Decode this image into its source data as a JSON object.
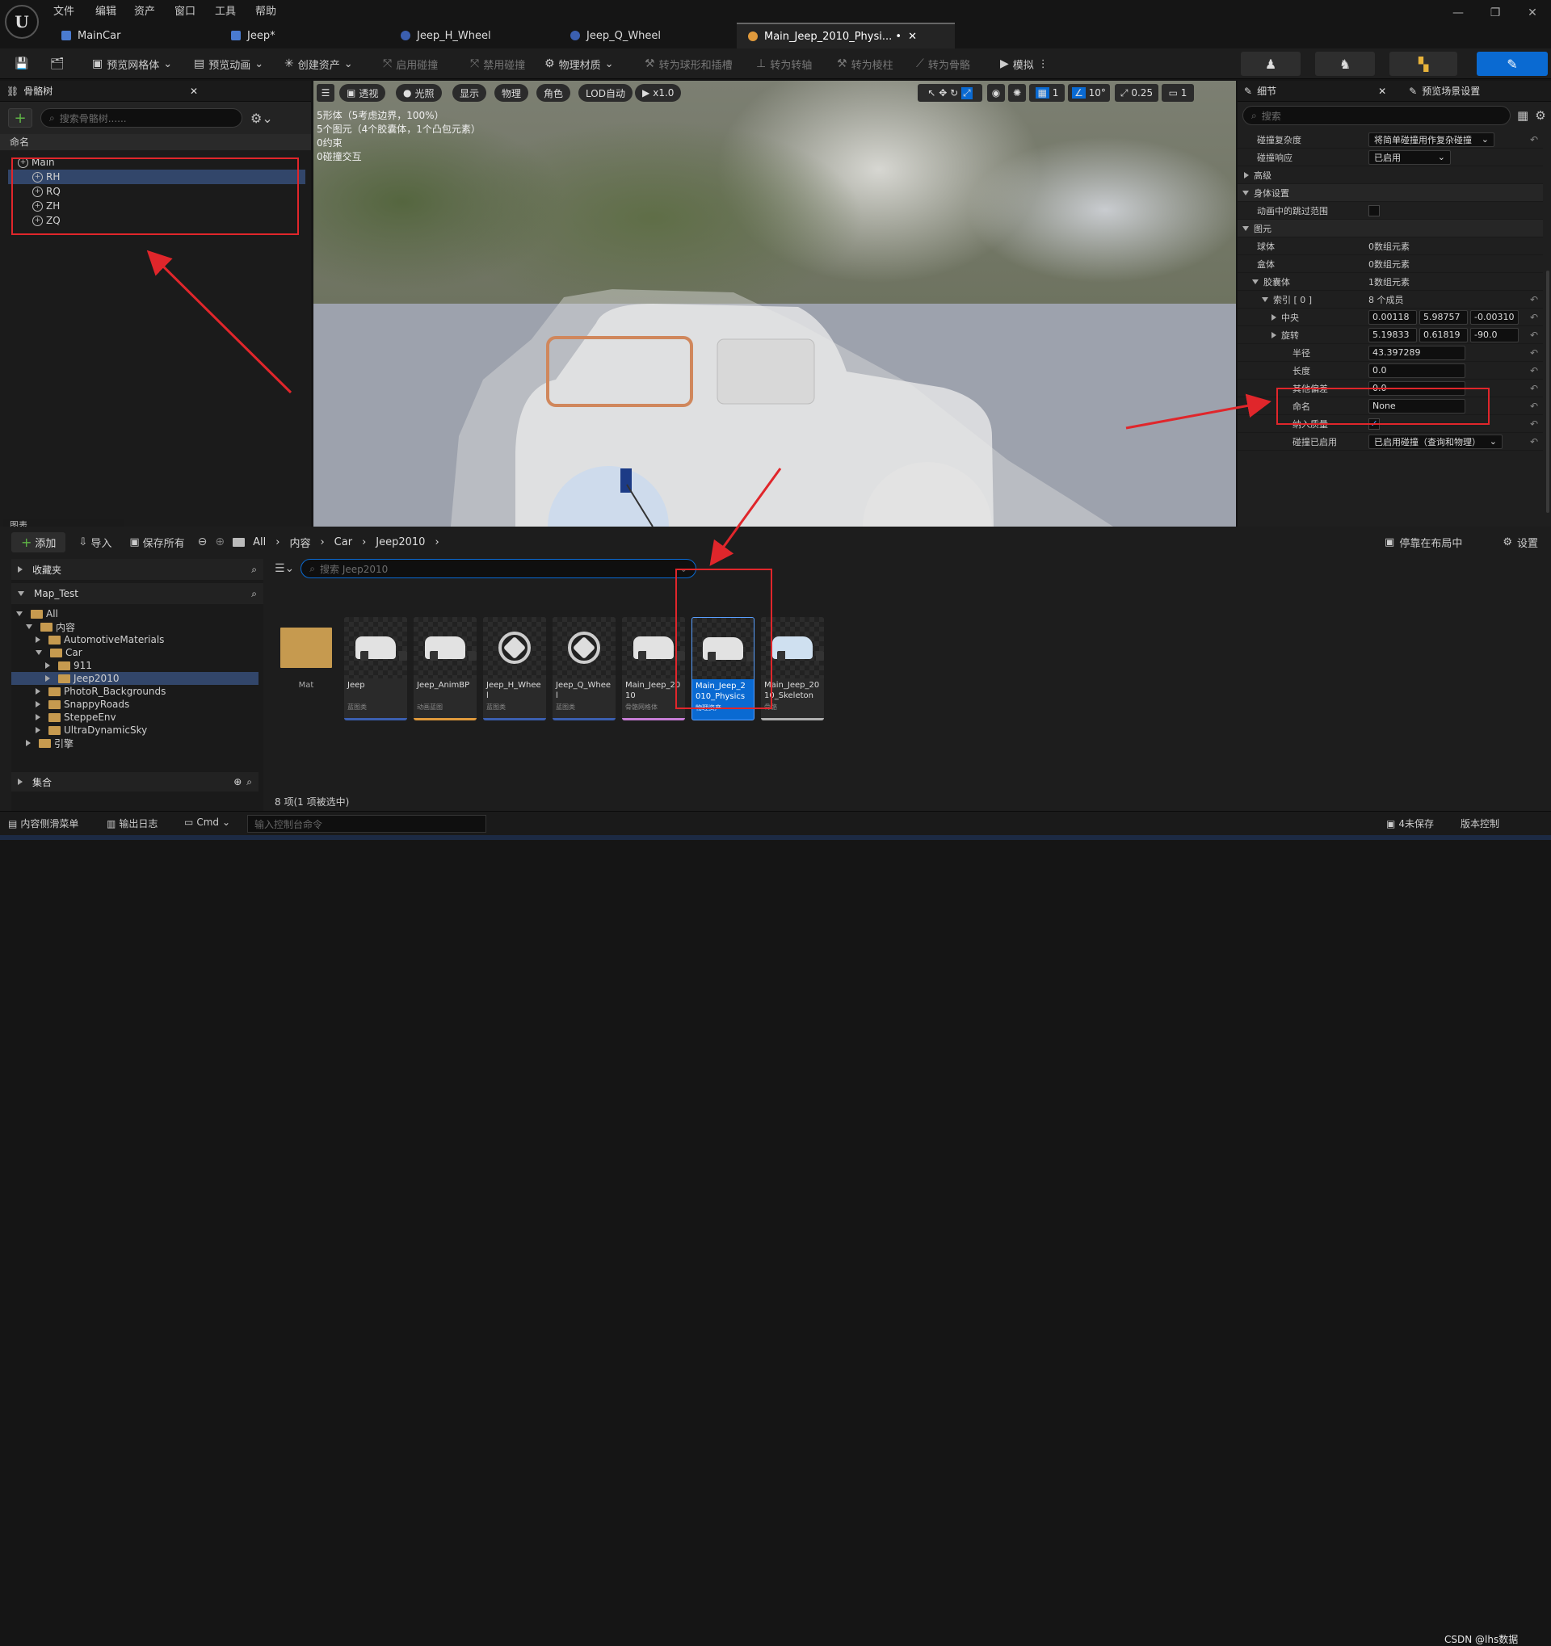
{
  "menu": {
    "file": "文件",
    "edit": "编辑",
    "asset": "资产",
    "window": "窗口",
    "tools": "工具",
    "help": "帮助"
  },
  "tabs": [
    {
      "label": "MainCar"
    },
    {
      "label": "Jeep*"
    },
    {
      "label": "Jeep_H_Wheel"
    },
    {
      "label": "Jeep_Q_Wheel"
    },
    {
      "label": "Main_Jeep_2010_Physi... •"
    }
  ],
  "toolbar": {
    "preview_mesh": "预览网格体",
    "preview_anim": "预览动画",
    "create_asset": "创建资产",
    "enable_collision": "启用碰撞",
    "disable_collision": "禁用碰撞",
    "physics_material": "物理材质",
    "to_sphere": "转为球形和插槽",
    "to_axis": "转为转轴",
    "to_prismatic": "转为棱柱",
    "to_bone": "转为骨骼",
    "simulate": "模拟"
  },
  "skeleton_panel": {
    "title": "骨骼树",
    "search_placeholder": "搜索骨骼树......",
    "column": "命名",
    "bones": [
      "Main",
      "RH",
      "RQ",
      "ZH",
      "ZQ"
    ]
  },
  "viewport": {
    "perspective": "透视",
    "lit": "光照",
    "show": "显示",
    "physics": "物理",
    "character": "角色",
    "lod": "LOD自动",
    "speed": "x1.0",
    "grid_size": "1",
    "angle": "10°",
    "scale": "0.25",
    "camera_speed": "1",
    "stats": [
      "5形体（5考虑边界，100%）",
      "5个图元（4个胶囊体，1个凸包元素）",
      "0约束",
      "0碰撞交互"
    ]
  },
  "details": {
    "tab": "细节",
    "tab2": "预览场景设置",
    "search_placeholder": "搜索",
    "rows": {
      "collision_complexity_label": "碰撞复杂度",
      "collision_complexity_value": "将简单碰撞用作复杂碰撞",
      "collision_response_label": "碰撞响应",
      "collision_response_value": "已启用",
      "advanced": "高级",
      "body_setup": "身体设置",
      "skip_range": "动画中的跳过范围",
      "primitives": "图元",
      "spheres_label": "球体",
      "spheres_value": "0数组元素",
      "boxes_label": "盒体",
      "boxes_value": "0数组元素",
      "capsules_label": "胶囊体",
      "capsules_value": "1数组元素",
      "index_label": "索引 [ 0 ]",
      "index_value": "8 个成员",
      "center_label": "中央",
      "center_values": [
        "0.00118",
        "5.98757",
        "-0.00310"
      ],
      "rotation_label": "旋转",
      "rotation_values": [
        "5.19833",
        "0.61819",
        "-90.0"
      ],
      "radius_label": "半径",
      "radius_value": "43.397289",
      "length_label": "长度",
      "length_value": "0.0",
      "offset_label": "其他偏差",
      "offset_value": "0.0",
      "name_label": "命名",
      "name_value": "None",
      "mass_label": "纳入质量",
      "collision_enabled_label": "碰撞已启用",
      "collision_enabled_value": "已启用碰撞（查询和物理）"
    }
  },
  "graph_tab": "图表",
  "content_browser": {
    "add": "添加",
    "import": "导入",
    "save_all": "保存所有",
    "breadcrumb": [
      "All",
      "内容",
      "Car",
      "Jeep2010"
    ],
    "dock": "停靠在布局中",
    "settings": "设置",
    "favorites": "收藏夹",
    "project": "Map_Test",
    "search_placeholder": "搜索 Jeep2010",
    "tree": [
      "All",
      "内容",
      "AutomotiveMaterials",
      "Car",
      "911",
      "Jeep2010",
      "PhotoR_Backgrounds",
      "SnappyRoads",
      "SteppeEnv",
      "UltraDynamicSky",
      "引擎"
    ],
    "collections": "集合",
    "count": "8 项(1 项被选中)",
    "assets": [
      {
        "name": "Mat",
        "type": ""
      },
      {
        "name": "Jeep",
        "type": "蓝图类"
      },
      {
        "name": "Jeep_AnimBP",
        "type": "动画蓝图"
      },
      {
        "name": "Jeep_H_Wheel",
        "type": "蓝图类"
      },
      {
        "name": "Jeep_Q_Wheel",
        "type": "蓝图类"
      },
      {
        "name": "Main_Jeep_2010",
        "type": "骨骼网格体"
      },
      {
        "name": "Main_Jeep_2010_Physics",
        "type": "物理资产"
      },
      {
        "name": "Main_Jeep_2010_Skeleton",
        "type": "骨骼"
      }
    ]
  },
  "statusbar": {
    "content_drawer": "内容侧滑菜单",
    "output_log": "输出日志",
    "cmd": "Cmd",
    "console_placeholder": "输入控制台命令",
    "unsaved": "4未保存",
    "source_control": "版本控制",
    "watermark": "CSDN @lhs数据"
  },
  "colors": {
    "accent": "#0a6ad2",
    "annotation": "#e0262b",
    "selection": "#32466a"
  }
}
